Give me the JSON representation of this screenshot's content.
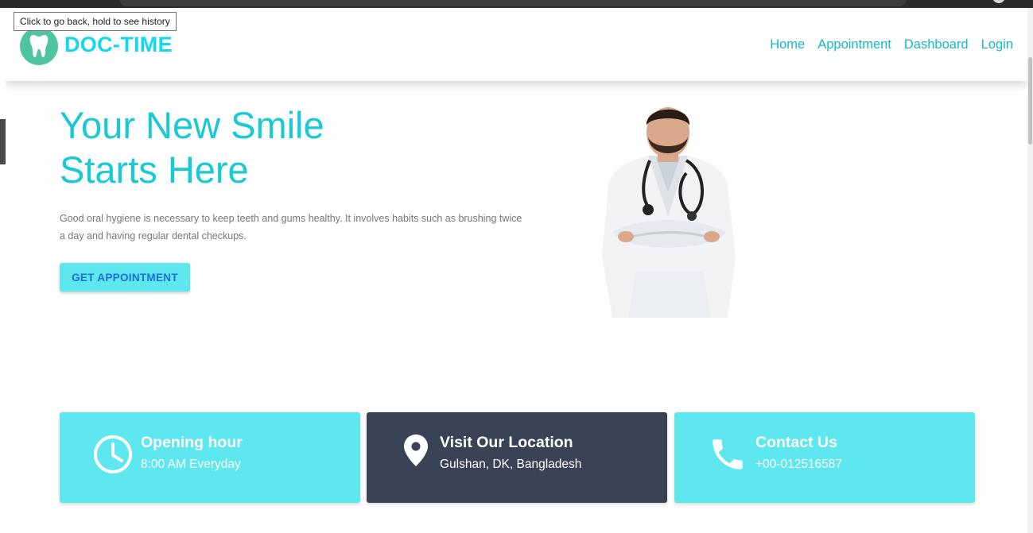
{
  "tooltip": "Click to go back, hold to see history",
  "brand": {
    "name": "DOC-TIME",
    "logo_icon": "tooth-icon",
    "logo_color": "#4fc4a0",
    "brand_color": "#11d9ea"
  },
  "nav": {
    "items": [
      {
        "label": "Home"
      },
      {
        "label": "Appointment"
      },
      {
        "label": "Dashboard"
      },
      {
        "label": "Login"
      }
    ]
  },
  "hero": {
    "title_line1": "Your New Smile",
    "title_line2": "Starts Here",
    "description": "Good oral hygiene is necessary to keep teeth and gums healthy. It involves habits such as brushing twice a day and having regular dental checkups.",
    "cta_label": "GET APPOINTMENT",
    "image": "doctor-with-stethoscope"
  },
  "cards": [
    {
      "icon": "clock-icon",
      "title": "Opening hour",
      "subtitle": "8:00 AM Everyday",
      "color": "#5ee7ee"
    },
    {
      "icon": "location-pin-icon",
      "title": "Visit Our Location",
      "subtitle": "Gulshan, DK, Bangladesh",
      "color": "#3a4256"
    },
    {
      "icon": "phone-icon",
      "title": "Contact Us",
      "subtitle": "+00-012516587",
      "color": "#5ee7ee"
    }
  ]
}
